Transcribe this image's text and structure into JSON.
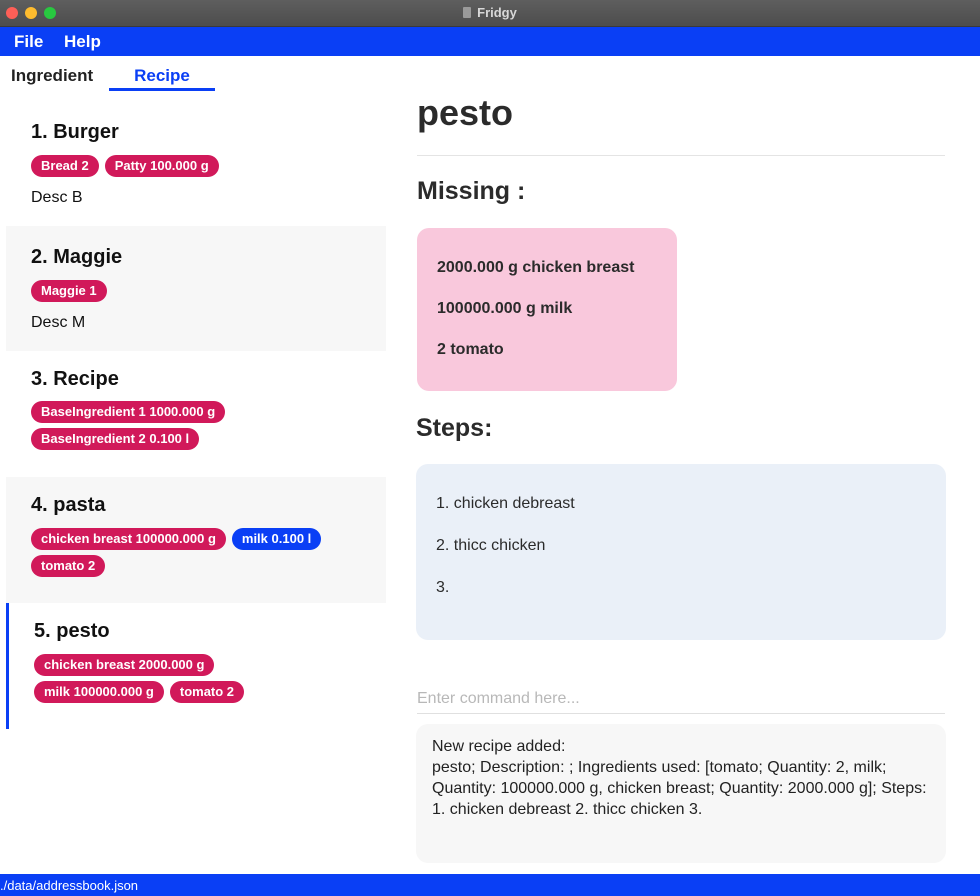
{
  "window": {
    "title": "Fridgy"
  },
  "menu": {
    "file": "File",
    "help": "Help"
  },
  "tabs": {
    "ingredient": "Ingredient",
    "recipe": "Recipe"
  },
  "recipes": [
    {
      "title": "1.  Burger",
      "tags": [
        "Bread 2",
        "Patty 100.000 g"
      ],
      "desc": "Desc B"
    },
    {
      "title": "2.  Maggie",
      "tags": [
        "Maggie 1"
      ],
      "desc": "Desc M"
    },
    {
      "title": "3.  Recipe",
      "tags": [
        "BaseIngredient 1 1000.000 g",
        "BaseIngredient 2 0.100 l"
      ],
      "desc": ""
    },
    {
      "title": "4.  pasta",
      "tags": [
        "chicken breast 100000.000 g",
        "milk 0.100 l",
        "tomato 2"
      ],
      "desc": ""
    },
    {
      "title": "5.  pesto",
      "tags": [
        "chicken breast 2000.000 g",
        "milk 100000.000 g",
        "tomato 2"
      ],
      "desc": ""
    }
  ],
  "detail": {
    "title": "pesto",
    "missing_heading": "Missing :",
    "missing": [
      "2000.000 g chicken breast",
      "100000.000 g milk",
      "2 tomato"
    ],
    "steps_heading": "Steps:",
    "steps": [
      "1. chicken debreast",
      "2. thicc chicken",
      "3."
    ]
  },
  "command": {
    "placeholder": "Enter command here..."
  },
  "result": {
    "line1": "New recipe added:",
    "line2": "pesto; Description: ; Ingredients used: [tomato; Quantity: 2, milk; Quantity: 100000.000 g, chicken breast; Quantity: 2000.000 g]; Steps: 1. chicken debreast 2. thicc chicken 3."
  },
  "status": {
    "path": "./data/addressbook.json"
  },
  "colors": {
    "accent": "#0a3ff5",
    "tag": "#d1195a",
    "missing_bg": "#f9c8dc",
    "steps_bg": "#eaf0f8"
  }
}
